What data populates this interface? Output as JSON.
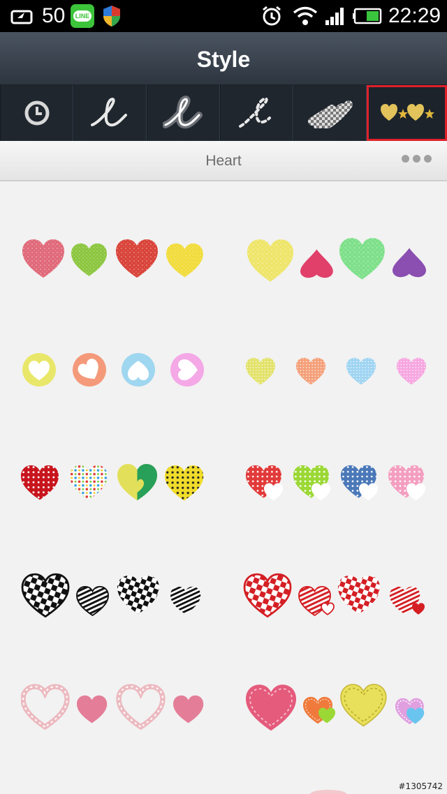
{
  "status_bar": {
    "notification_count": "50",
    "line_label": "LINE",
    "time": "22:29",
    "icons": [
      "recycle-icon",
      "line-app-icon",
      "shield-icon",
      "alarm-icon",
      "wifi-icon",
      "signal-icon",
      "battery-icon"
    ]
  },
  "header": {
    "title": "Style"
  },
  "tabs": [
    {
      "name": "recent",
      "icon": "clock-icon"
    },
    {
      "name": "pen",
      "icon": "cursive-pen-icon"
    },
    {
      "name": "glow",
      "icon": "glow-pen-icon"
    },
    {
      "name": "dotted",
      "icon": "dotted-pen-icon"
    },
    {
      "name": "pattern",
      "icon": "pattern-brush-icon"
    },
    {
      "name": "stamp",
      "icon": "heart-star-stamp-icon",
      "selected": true
    }
  ],
  "section": {
    "title": "Heart"
  },
  "watermark": "#1305742",
  "colors": {
    "status_bg": "#000000",
    "title_bar": "#3a434e",
    "tab_bar": "#1f262e",
    "selected_outline": "#e0202a",
    "background": "#f2f2f2"
  },
  "sets": [
    {
      "name": "crayon-hearts",
      "colors": [
        "#e06a7a",
        "#8cc63e",
        "#d9443a",
        "#f1dc3b"
      ]
    },
    {
      "name": "pastel-crayon-hearts",
      "colors": [
        "#eee56a",
        "#e0406a",
        "#7ee08a",
        "#8a4fb0"
      ]
    },
    {
      "name": "circle-hearts",
      "colors": [
        "#e8e76a",
        "#f49a7a",
        "#9fd6f0",
        "#f4a8e6"
      ]
    },
    {
      "name": "polka-mini-hearts",
      "colors": [
        "#e2e26a",
        "#f4a07a",
        "#9fd4f2",
        "#f6a6e0"
      ]
    },
    {
      "name": "polka-dot-hearts",
      "colors": [
        "#c8151d",
        "#ffffff",
        "#e2e05a",
        "#f0dc2a"
      ]
    },
    {
      "name": "double-hearts",
      "colors": [
        "#e23a3a",
        "#9bd835",
        "#4a78b8",
        "#f49ec0"
      ]
    },
    {
      "name": "black-check-hearts",
      "colors": [
        "#111111",
        "#111111",
        "#111111",
        "#111111"
      ]
    },
    {
      "name": "red-check-hearts",
      "colors": [
        "#d41f24",
        "#d41f24",
        "#d41f24",
        "#d41f24"
      ]
    },
    {
      "name": "pink-outline-hearts",
      "colors": [
        "#ecbac0",
        "#e47e98",
        "#ecbac0",
        "#e47e98"
      ]
    },
    {
      "name": "stitched-hearts",
      "colors": [
        "#e45b7c",
        "#ef7a3c",
        "#e8e05a",
        "#e0a0e0"
      ]
    }
  ]
}
